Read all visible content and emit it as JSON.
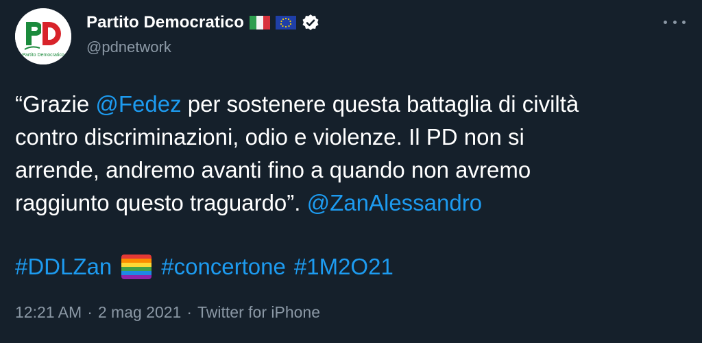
{
  "author": {
    "display_name": "Partito Democratico",
    "handle": "@pdnetwork",
    "avatar_text": "PD",
    "avatar_caption": "Partito Democratico",
    "flags": [
      "italy-flag-icon",
      "eu-flag-icon"
    ],
    "verified_icon": "verified-badge-icon"
  },
  "tweet": {
    "line1_pre": "“Grazie ",
    "mention1": "@Fedez",
    "line1_post": " per sostenere questa battaglia di civiltà",
    "line2": "contro discriminazioni, odio e violenze. Il PD non si",
    "line3": "arrende, andremo avanti fino a quando non avremo",
    "line4_pre": "raggiunto questo traguardo”. ",
    "mention2": "@ZanAlessandro",
    "hashtag1": "#DDLZan",
    "hashtag2": "#concertone",
    "hashtag3": "#1M2O21",
    "emoji_icon": "rainbow-flag-icon"
  },
  "meta": {
    "time": "12:21 AM",
    "separator": "·",
    "date": "2 mag 2021",
    "source": "Twitter for iPhone"
  },
  "colors": {
    "background": "#15202b",
    "link": "#1d9bf0",
    "secondary_text": "#8b98a5"
  }
}
